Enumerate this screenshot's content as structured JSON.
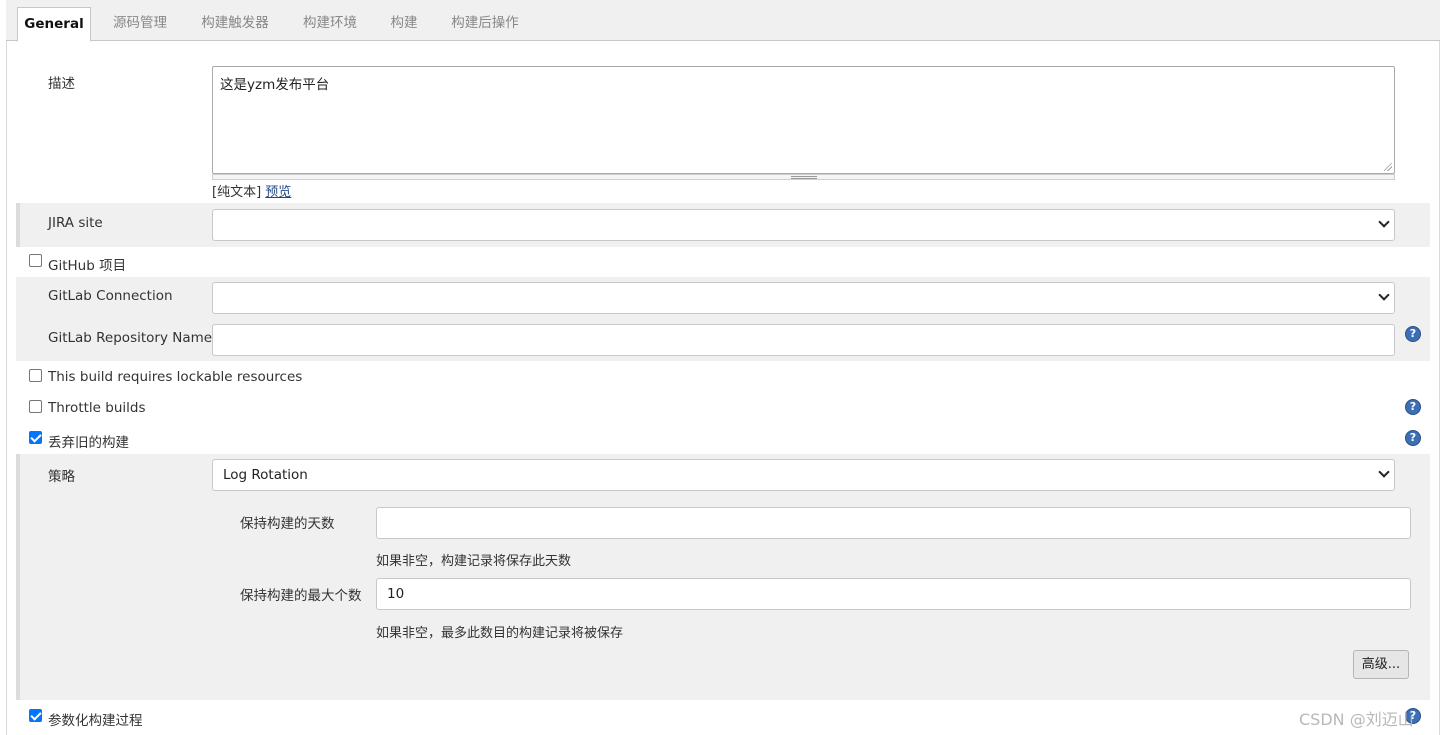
{
  "tabs": [
    "General",
    "源码管理",
    "构建触发器",
    "构建环境",
    "构建",
    "构建后操作"
  ],
  "description": {
    "label": "描述",
    "value": "这是yzm发布平台",
    "format_plain": "[纯文本]",
    "preview_link": "预览"
  },
  "jira": {
    "label": "JIRA site",
    "value": ""
  },
  "github_project": {
    "label": "GitHub 项目",
    "checked": false
  },
  "gitlab": {
    "connection_label": "GitLab Connection",
    "connection_value": "",
    "repo_label": "GitLab Repository Name",
    "repo_value": ""
  },
  "lockable": {
    "label": "This build requires lockable resources",
    "checked": false
  },
  "throttle": {
    "label": "Throttle builds",
    "checked": false
  },
  "discard": {
    "label": "丢弃旧的构建",
    "checked": true,
    "strategy_label": "策略",
    "strategy_value": "Log Rotation",
    "days_label": "保持构建的天数",
    "days_value": "",
    "days_hint": "如果非空，构建记录将保存此天数",
    "max_label": "保持构建的最大个数",
    "max_value": "10",
    "max_hint": "如果非空，最多此数目的构建记录将被保存",
    "advanced_button": "高级..."
  },
  "parameterized": {
    "label": "参数化构建过程",
    "checked": true
  },
  "help_glyph": "?",
  "watermark": "CSDN @刘迈山",
  "colors": {
    "accent": "#0075ff",
    "help": "#3d6fb5",
    "band": "#f0f0f0"
  }
}
